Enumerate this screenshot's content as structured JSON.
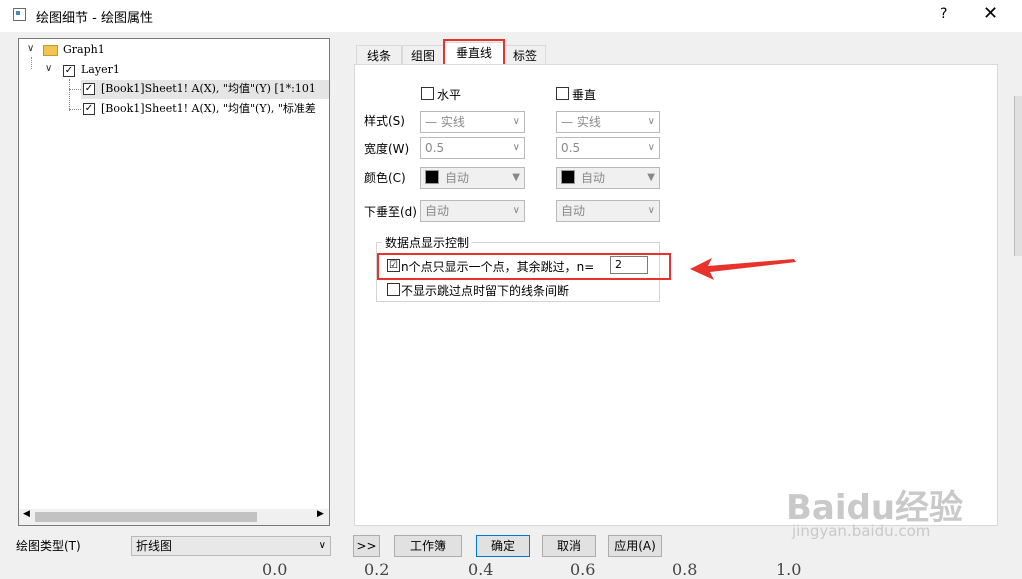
{
  "window": {
    "title": "绘图细节 - 绘图属性",
    "help_label": "?",
    "close_label": "✕"
  },
  "tree": {
    "graph": "Graph1",
    "layer": "Layer1",
    "items": [
      "[Book1]Sheet1! A(X), \"均值\"(Y) [1*:101",
      "[Book1]Sheet1! A(X), \"均值\"(Y), \"标准差"
    ]
  },
  "tabs": [
    "线条",
    "组图",
    "垂直线",
    "标签"
  ],
  "active_tab": "垂直线",
  "form": {
    "horizontal_label": "水平",
    "vertical_label": "垂直",
    "style_label": "样式(S)",
    "width_label": "宽度(W)",
    "color_label": "颜色(C)",
    "drop_to_label": "下垂至(d)",
    "style_value": "— 实线",
    "width_value": "0.5",
    "color_value": "自动",
    "drop_to_value": "自动"
  },
  "group": {
    "title": "数据点显示控制",
    "skip_label": "n个点只显示一个点，其余跳过，n=",
    "skip_value": "2",
    "skip_checked": "☑",
    "nogap_label": "不显示跳过点时留下的线条间断"
  },
  "bottom": {
    "plot_type_label": "绘图类型(T)",
    "plot_type_value": "折线图",
    "expand_label": ">>",
    "workbook_label": "工作簿",
    "ok_label": "确定",
    "cancel_label": "取消",
    "apply_label": "应用(A)"
  },
  "background": {
    "axis_numbers": [
      "0.0",
      "0.2",
      "0.4",
      "0.6",
      "0.8",
      "1.0"
    ],
    "watermark_logo": "Baidu经验",
    "watermark_url": "jingyan.baidu.com"
  },
  "colors": {
    "highlight_red": "#e8322c",
    "primary_blue": "#0078d7"
  }
}
